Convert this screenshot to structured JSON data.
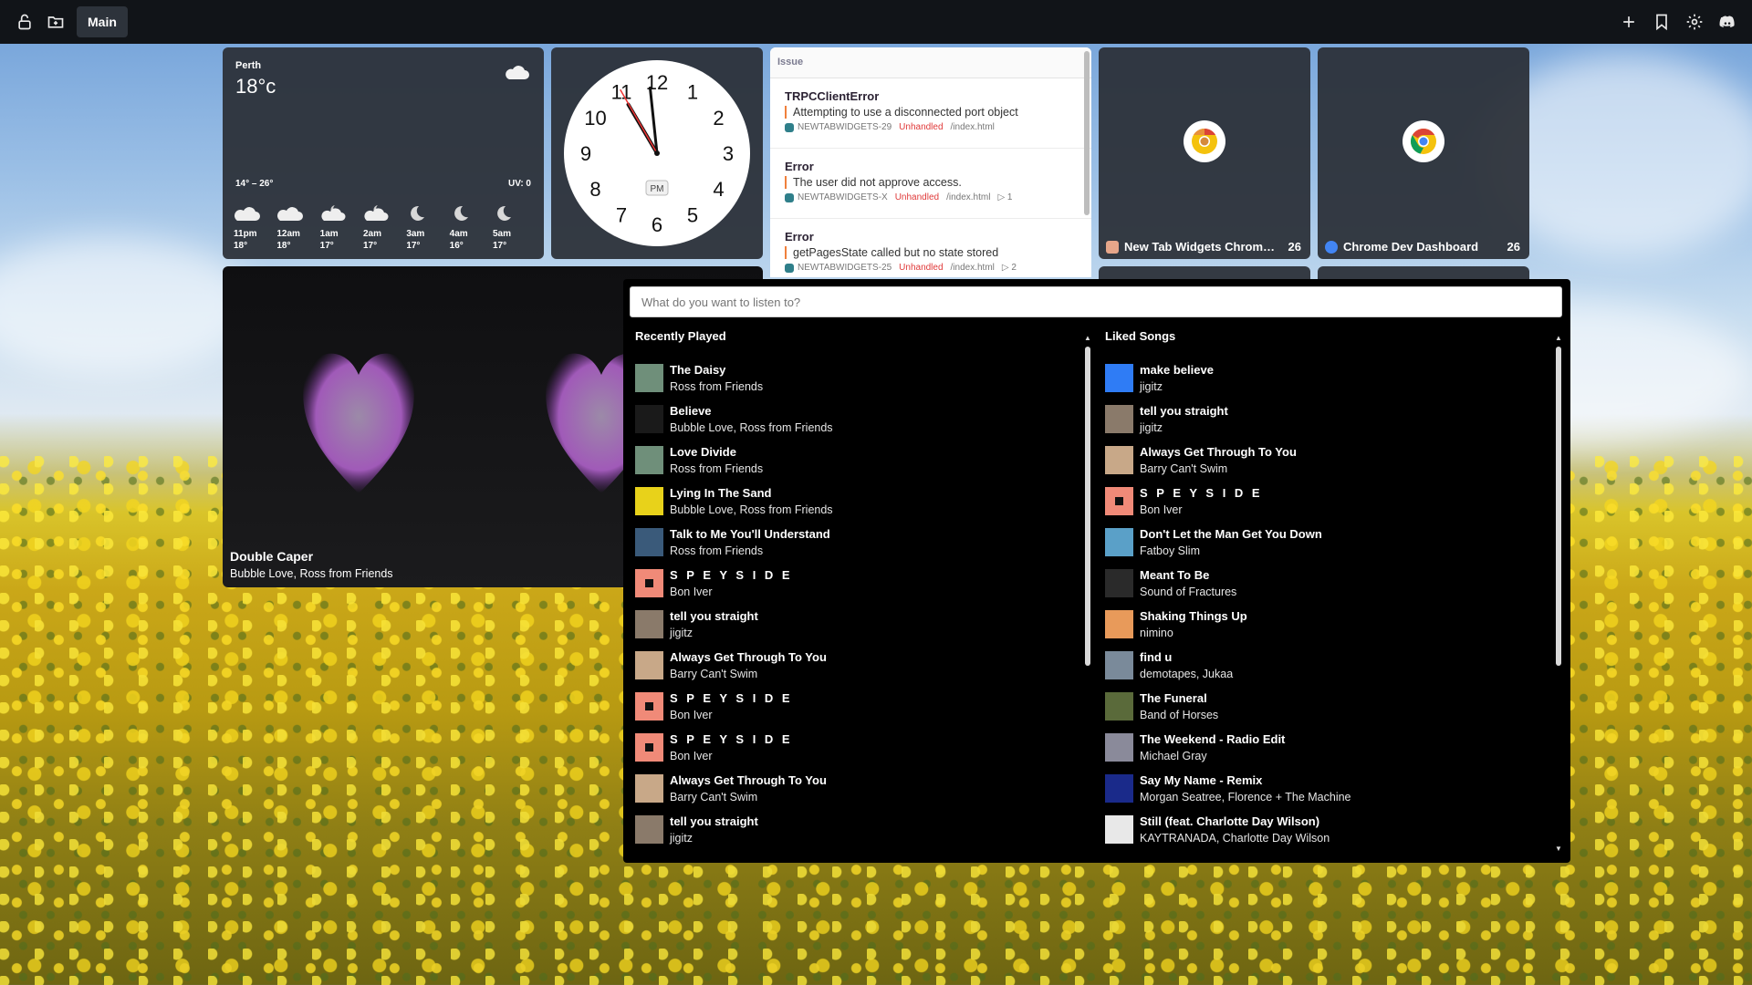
{
  "topbar": {
    "icons": [
      "lock-icon",
      "folder-icon",
      "plus-icon",
      "bookmark-icon",
      "gear-icon",
      "discord-icon"
    ],
    "tab_label": "Main"
  },
  "weather": {
    "city": "Perth",
    "temp": "18°c",
    "range": "14° – 26°",
    "uv": "UV: 0",
    "hours": [
      {
        "time": "11pm",
        "temp": "18°",
        "icon": "cloud"
      },
      {
        "time": "12am",
        "temp": "18°",
        "icon": "cloud"
      },
      {
        "time": "1am",
        "temp": "17°",
        "icon": "cloud-night"
      },
      {
        "time": "2am",
        "temp": "17°",
        "icon": "cloud-night"
      },
      {
        "time": "3am",
        "temp": "17°",
        "icon": "moon"
      },
      {
        "time": "4am",
        "temp": "16°",
        "icon": "moon"
      },
      {
        "time": "5am",
        "temp": "17°",
        "icon": "moon"
      }
    ]
  },
  "clock": {
    "numbers": [
      "12",
      "1",
      "2",
      "3",
      "4",
      "5",
      "6",
      "7",
      "8",
      "9",
      "10",
      "11"
    ],
    "period": "PM",
    "hour": 10,
    "minute": 59,
    "second": 55
  },
  "issues": {
    "header": "Issue",
    "items": [
      {
        "title": "TRPCClientError",
        "message": "Attempting to use a disconnected port object",
        "project": "NEWTABWIDGETS-29",
        "status": "Unhandled",
        "path": "/index.html",
        "events": ""
      },
      {
        "title": "Error",
        "message": "The user did not approve access.",
        "project": "NEWTABWIDGETS-X",
        "status": "Unhandled",
        "path": "/index.html",
        "events": "▷ 1"
      },
      {
        "title": "Error",
        "message": "getPagesState called but no state stored",
        "project": "NEWTABWIDGETS-25",
        "status": "Unhandled",
        "path": "/index.html",
        "events": "▷ 2"
      }
    ]
  },
  "tiles": [
    {
      "name": "New Tab Widgets Chrome ...",
      "count": "26"
    },
    {
      "name": "Chrome Dev Dashboard",
      "count": "26"
    }
  ],
  "now_playing": {
    "title": "Double Caper",
    "artist": "Bubble Love, Ross from Friends"
  },
  "music": {
    "search_placeholder": "What do you want to listen to?",
    "recent_title": "Recently Played",
    "liked_title": "Liked Songs",
    "recent": [
      {
        "title": "The Daisy",
        "artist": "Ross from Friends",
        "color": "#6f8f7a"
      },
      {
        "title": "Believe",
        "artist": "Bubble Love, Ross from Friends",
        "color": "#1a1a1a"
      },
      {
        "title": "Love Divide",
        "artist": "Ross from Friends",
        "color": "#6f8f7a"
      },
      {
        "title": "Lying In The Sand",
        "artist": "Bubble Love, Ross from Friends",
        "color": "#e8d21a"
      },
      {
        "title": "Talk to Me You'll Understand",
        "artist": "Ross from Friends",
        "color": "#3a5a7a"
      },
      {
        "title": "S P E Y S I D E",
        "artist": "Bon Iver",
        "color": "#f08a78"
      },
      {
        "title": "tell you straight",
        "artist": "jigitz",
        "color": "#8a7a6a"
      },
      {
        "title": "Always Get Through To You",
        "artist": "Barry Can't Swim",
        "color": "#c8a888"
      },
      {
        "title": "S P E Y S I D E",
        "artist": "Bon Iver",
        "color": "#f08a78"
      },
      {
        "title": "S P E Y S I D E",
        "artist": "Bon Iver",
        "color": "#f08a78"
      },
      {
        "title": "Always Get Through To You",
        "artist": "Barry Can't Swim",
        "color": "#c8a888"
      },
      {
        "title": "tell you straight",
        "artist": "jigitz",
        "color": "#8a7a6a"
      }
    ],
    "liked": [
      {
        "title": "make believe",
        "artist": "jigitz",
        "color": "#2f7cf5"
      },
      {
        "title": "tell you straight",
        "artist": "jigitz",
        "color": "#8a7a6a"
      },
      {
        "title": "Always Get Through To You",
        "artist": "Barry Can't Swim",
        "color": "#c8a888"
      },
      {
        "title": "S P E Y S I D E",
        "artist": "Bon Iver",
        "color": "#f08a78"
      },
      {
        "title": "Don't Let the Man Get You Down",
        "artist": "Fatboy Slim",
        "color": "#5aa0c8"
      },
      {
        "title": "Meant To Be",
        "artist": "Sound of Fractures",
        "color": "#2a2a2a"
      },
      {
        "title": "Shaking Things Up",
        "artist": "nimino",
        "color": "#e89a5a"
      },
      {
        "title": "find u",
        "artist": "demotapes, Jukaa",
        "color": "#7a8a9a"
      },
      {
        "title": "The Funeral",
        "artist": "Band of Horses",
        "color": "#5a6a3a"
      },
      {
        "title": "The Weekend - Radio Edit",
        "artist": "Michael Gray",
        "color": "#8a8a9a"
      },
      {
        "title": "Say My Name - Remix",
        "artist": "Morgan Seatree, Florence + The Machine",
        "color": "#1a2a8a"
      },
      {
        "title": "Still (feat. Charlotte Day Wilson)",
        "artist": "KAYTRANADA, Charlotte Day Wilson",
        "color": "#e8e8e8"
      }
    ]
  }
}
